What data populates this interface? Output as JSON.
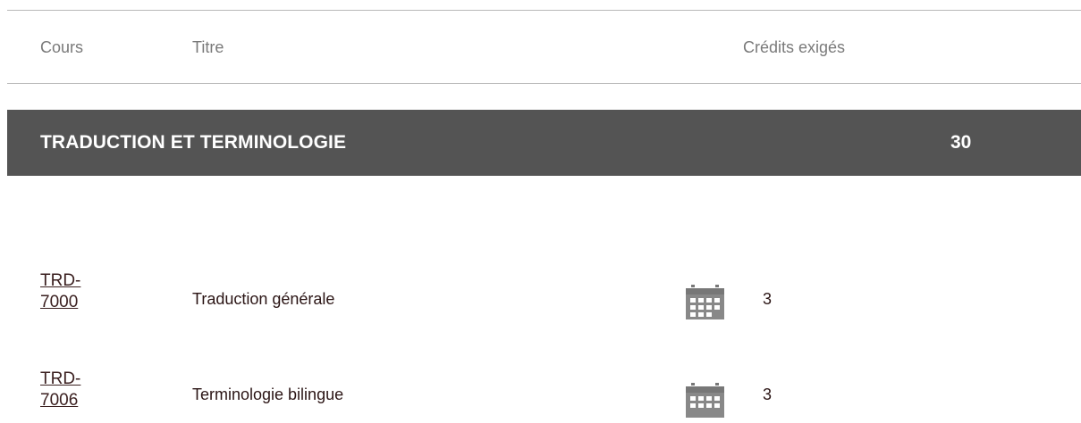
{
  "table_header": {
    "course": "Cours",
    "title": "Titre",
    "credits": "Crédits exigés"
  },
  "section": {
    "title": "TRADUCTION ET TERMINOLOGIE",
    "credits": "30"
  },
  "courses": [
    {
      "code_line1": "TRD-",
      "code_line2": "7000",
      "title": "Traduction générale",
      "credits": "3",
      "icon": "calendar-icon"
    },
    {
      "code_line1": "TRD-",
      "code_line2": "7006",
      "title": "Terminologie bilingue",
      "credits": "3",
      "icon": "calendar-icon"
    }
  ],
  "colors": {
    "section_bar": "#545454",
    "text": "#3a1f1f",
    "header_text": "#7a7a7a"
  }
}
